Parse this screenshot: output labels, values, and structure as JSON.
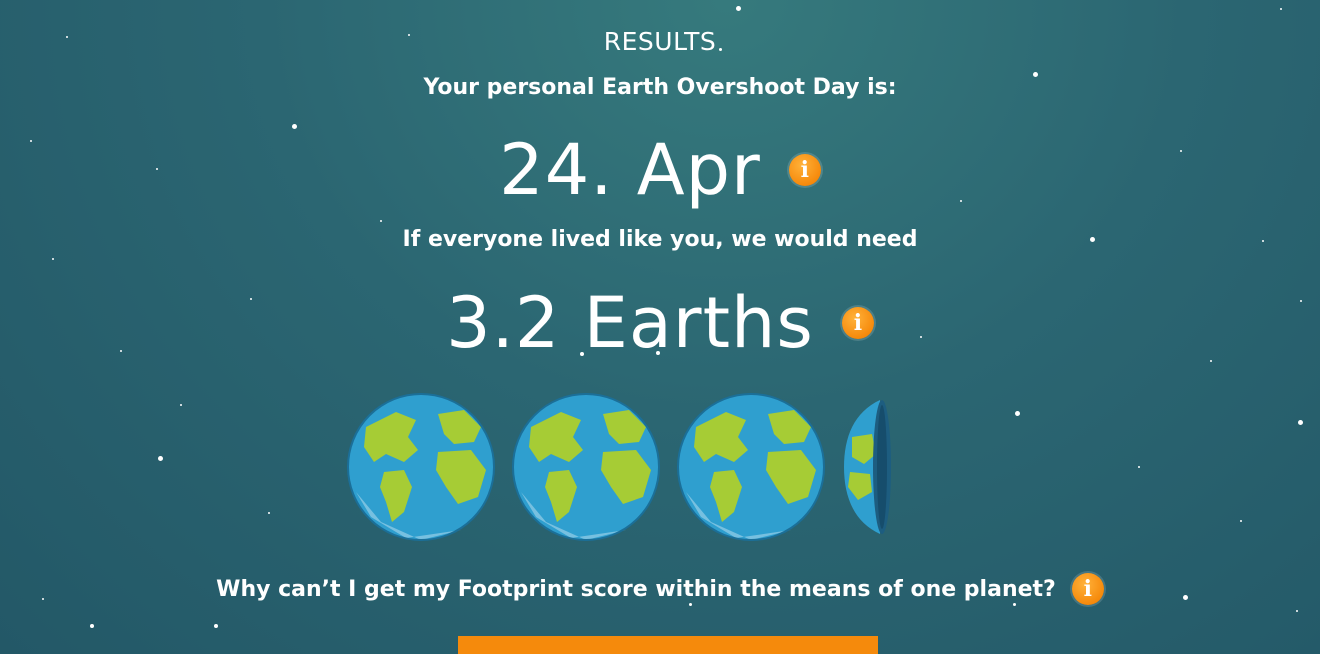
{
  "results": {
    "title": "RESULTS",
    "overshoot_label": "Your personal Earth Overshoot Day is:",
    "overshoot_date": "24. Apr",
    "earths_label": "If everyone lived like you, we would need",
    "earths_value": "3.2 Earths",
    "earths_count": 3.2,
    "question": "Why can’t I get my Footprint score within the means of one planet?"
  },
  "icons": {
    "info": "i"
  },
  "colors": {
    "background_top": "#367a7d",
    "background_bottom": "#235867",
    "accent_orange": "#f68a0c",
    "ocean": "#33a9d6",
    "land": "#a6cc35"
  }
}
